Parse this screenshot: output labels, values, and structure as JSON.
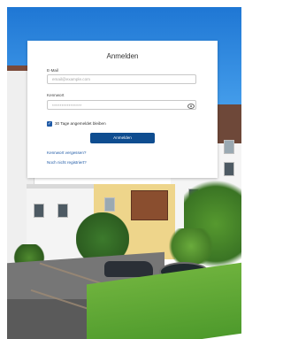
{
  "login": {
    "title": "Anmelden",
    "email_label": "E-Mail",
    "email_placeholder": "email@example.com",
    "password_label": "Kennwort",
    "password_value": "****************",
    "remember_label": "30 Tage angemeldet bleiben",
    "remember_checked": true,
    "submit_label": "Anmelden",
    "forgot_link": "Kennwort vergessen?",
    "register_link": "Noch nicht registriert?"
  },
  "colors": {
    "primary_button": "#0f4d90",
    "link": "#1f5aa6",
    "sky": "#1f77d4"
  },
  "icons": {
    "password_toggle": "eye-icon",
    "checkbox": "checkmark"
  }
}
